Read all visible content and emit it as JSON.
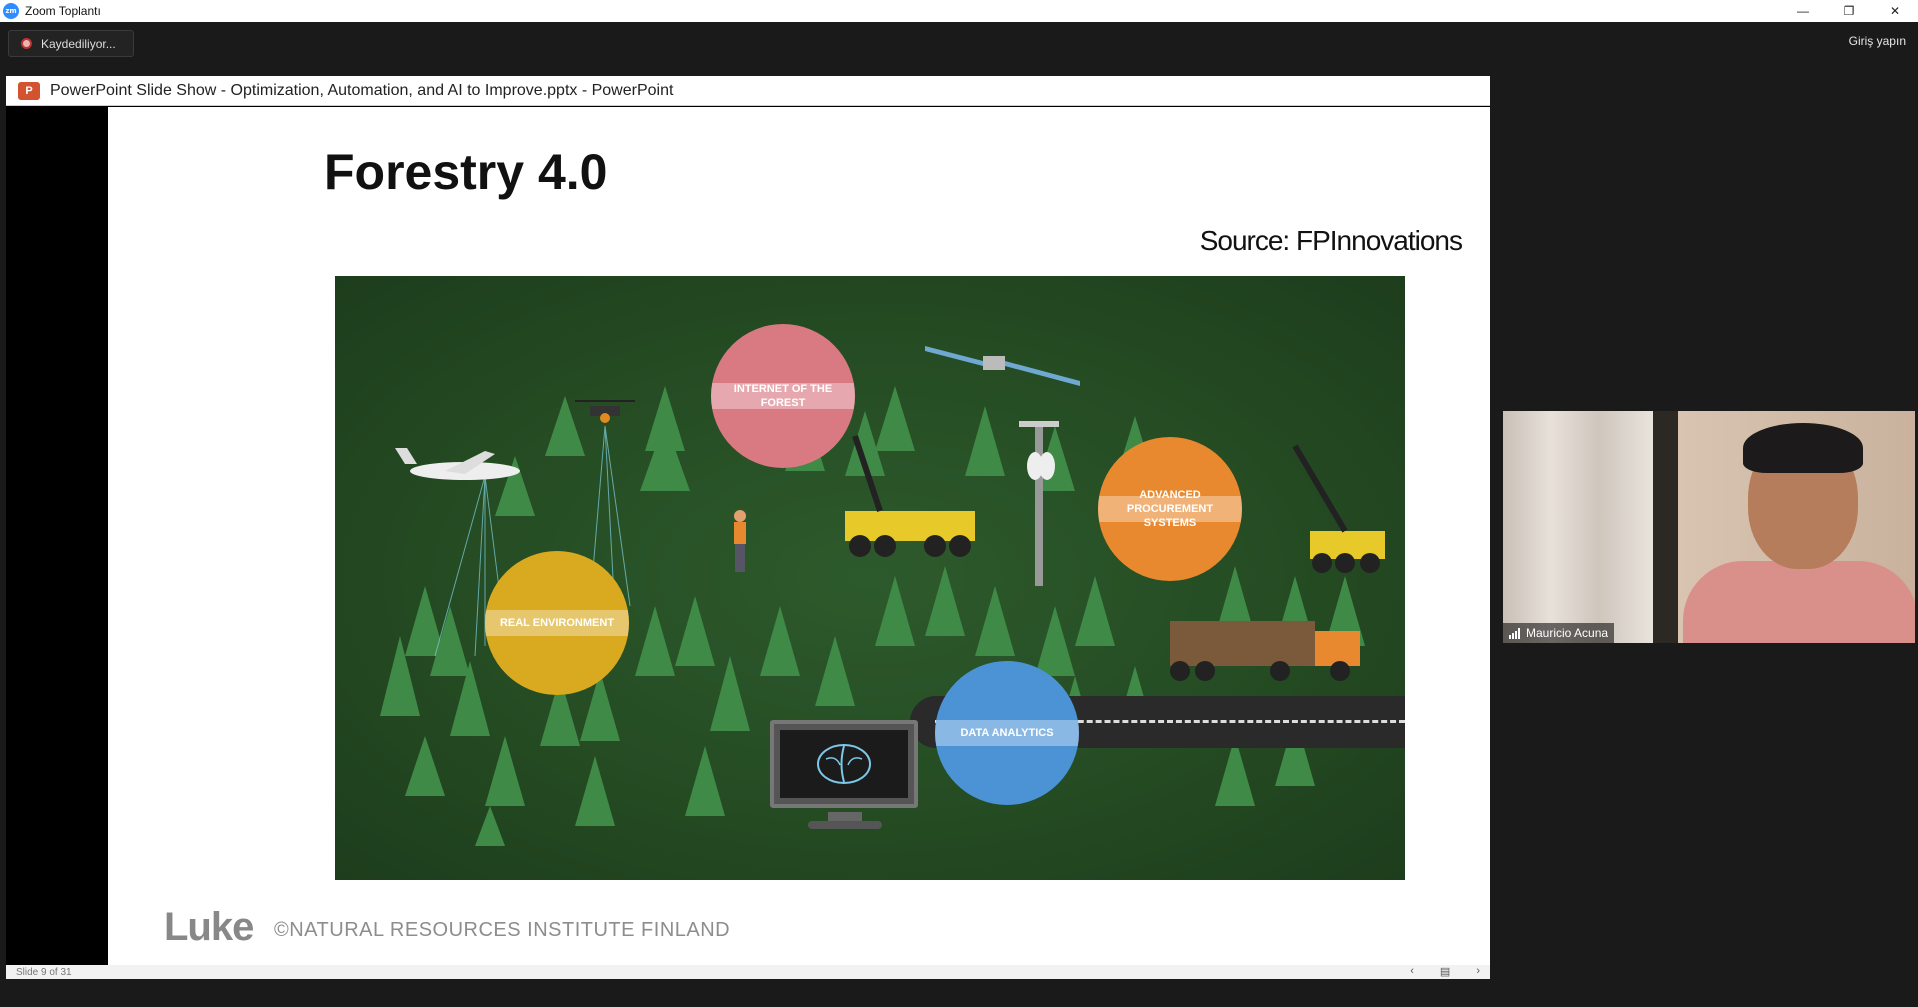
{
  "app": {
    "window_title": "Zoom Toplantı",
    "logo_text": "zm",
    "controls": {
      "minimize": "—",
      "restore": "❐",
      "close": "✕"
    }
  },
  "meeting": {
    "recording_label": "Kaydediliyor...",
    "signin_label": "Giriş yapın"
  },
  "powerpoint": {
    "window_title": "PowerPoint Slide Show  -  Optimization, Automation, and AI to Improve.pptx - PowerPoint",
    "logo_text": "P",
    "status_text": "Slide 9 of 31",
    "nav": {
      "prev": "‹",
      "notes": "▤",
      "next": "›"
    }
  },
  "slide": {
    "title": "Forestry 4.0",
    "source": "Source: FPInnovations",
    "illustration_labels": {
      "internet": "INTERNET OF THE FOREST",
      "procurement": "ADVANCED PROCUREMENT SYSTEMS",
      "real_env": "REAL ENVIRONMENT",
      "analytics": "DATA ANALYTICS"
    },
    "footer_logo": "Luke",
    "footer_text": "©NATURAL RESOURCES INSTITUTE FINLAND"
  },
  "participant": {
    "name": "Mauricio Acuna"
  },
  "colors": {
    "circle_internet": "#d97a83",
    "circle_procurement": "#e8892f",
    "circle_real_env": "#d9aa1f",
    "circle_analytics": "#4c93d6"
  }
}
